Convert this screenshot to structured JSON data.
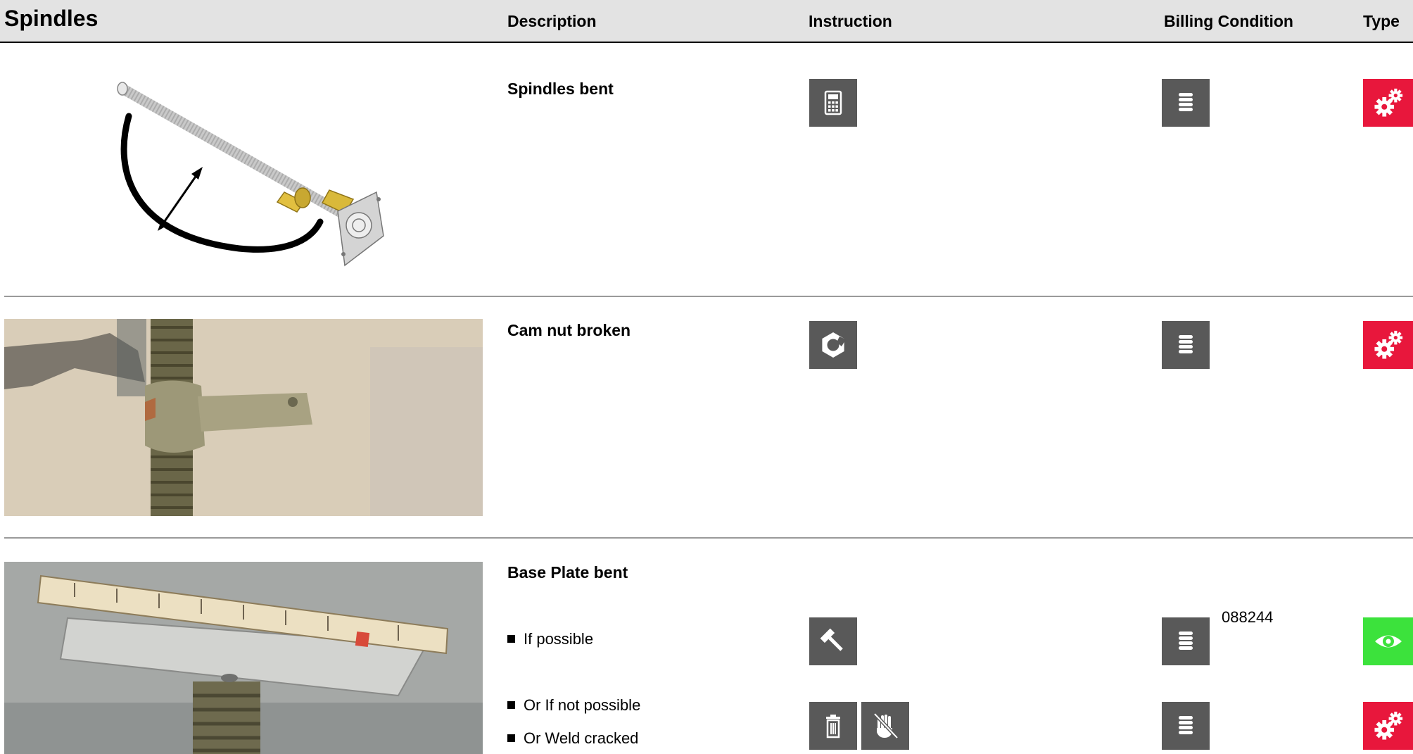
{
  "header": {
    "title": "Spindles",
    "columns": {
      "description": "Description",
      "instruction": "Instruction",
      "billing": "Billing Condition",
      "type": "Type"
    }
  },
  "rows": [
    {
      "description": "Spindles bent",
      "instruction_icons": [
        "calculator-icon"
      ],
      "billing_icon": "stack-icon",
      "type_icon": "gears-icon",
      "type_color": "#e8173c"
    },
    {
      "description": "Cam nut broken",
      "instruction_icons": [
        "broken-nut-icon"
      ],
      "billing_icon": "stack-icon",
      "type_icon": "gears-icon",
      "type_color": "#e8173c"
    },
    {
      "description": "Base Plate bent",
      "sub_items": [
        {
          "bullets": [
            "If possible"
          ],
          "instruction_icons": [
            "hammer-icon"
          ],
          "billing_icon": "stack-icon",
          "billing_ref": "088244",
          "type_icon": "eye-icon",
          "type_color": "#3ce23c"
        },
        {
          "bullets": [
            "Or If not possible",
            "Or Weld cracked"
          ],
          "instruction_icons": [
            "trash-icon",
            "no-hand-icon"
          ],
          "billing_icon": "stack-icon",
          "type_icon": "gears-icon",
          "type_color": "#e8173c"
        }
      ]
    }
  ]
}
